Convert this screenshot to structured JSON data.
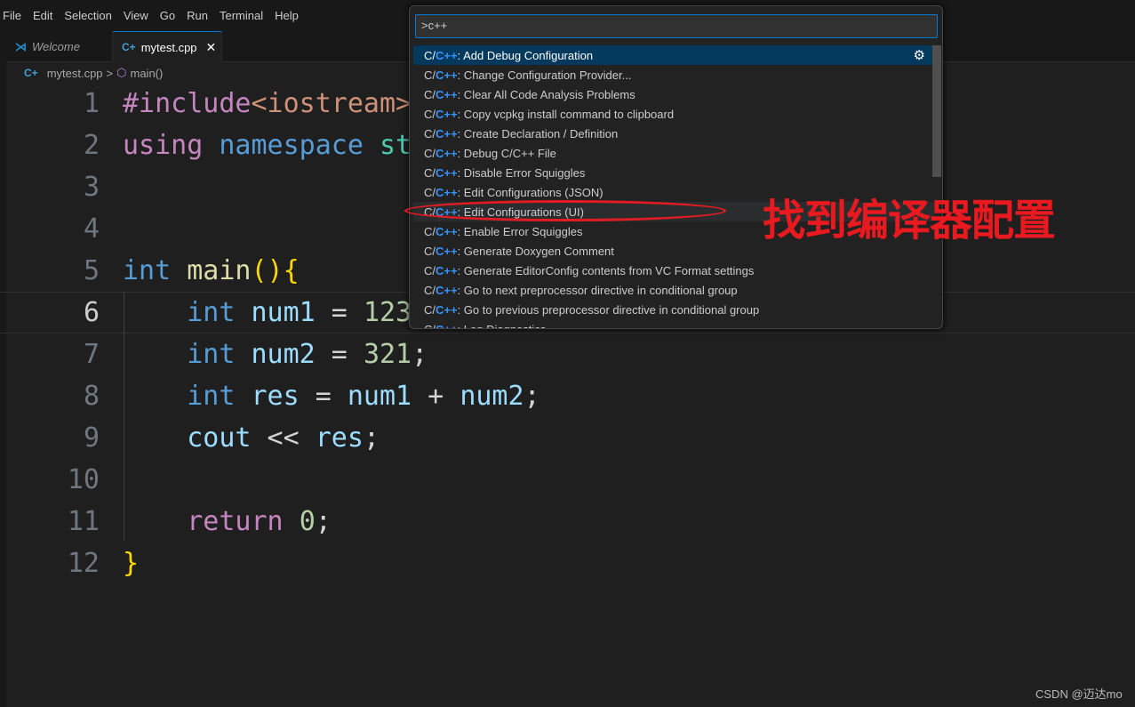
{
  "menu": [
    "File",
    "Edit",
    "Selection",
    "View",
    "Go",
    "Run",
    "Terminal",
    "Help"
  ],
  "tabs": [
    {
      "label": "Welcome",
      "icon": "vscode-icon"
    },
    {
      "label": "mytest.cpp",
      "icon": "cpp-file-icon",
      "close": "✕"
    }
  ],
  "breadcrumb": {
    "file": "mytest.cpp",
    "sep": ">",
    "symbol": "main()"
  },
  "code": {
    "lines": [
      [
        [
          "kp",
          "#include"
        ],
        [
          "ks",
          "<iostream>"
        ]
      ],
      [
        [
          "kp",
          "using"
        ],
        [
          "kw",
          " "
        ],
        [
          "kb",
          "namespace"
        ],
        [
          "kw",
          " "
        ],
        [
          "kt",
          "std"
        ],
        [
          "kw",
          ";"
        ]
      ],
      [],
      [],
      [
        [
          "kb",
          "int"
        ],
        [
          "kw",
          " "
        ],
        [
          "kf",
          "main"
        ],
        [
          "kbr",
          "(){"
        ]
      ],
      [
        [
          "kw",
          "    "
        ],
        [
          "kb",
          "int"
        ],
        [
          "kw",
          " "
        ],
        [
          "kv",
          "num1"
        ],
        [
          "kw",
          " = "
        ],
        [
          "kn",
          "123"
        ],
        [
          "kw",
          ";"
        ]
      ],
      [
        [
          "kw",
          "    "
        ],
        [
          "kb",
          "int"
        ],
        [
          "kw",
          " "
        ],
        [
          "kv",
          "num2"
        ],
        [
          "kw",
          " = "
        ],
        [
          "kn",
          "321"
        ],
        [
          "kw",
          ";"
        ]
      ],
      [
        [
          "kw",
          "    "
        ],
        [
          "kb",
          "int"
        ],
        [
          "kw",
          " "
        ],
        [
          "kv",
          "res"
        ],
        [
          "kw",
          " = "
        ],
        [
          "kv",
          "num1"
        ],
        [
          "kw",
          " + "
        ],
        [
          "kv",
          "num2"
        ],
        [
          "kw",
          ";"
        ]
      ],
      [
        [
          "kw",
          "    "
        ],
        [
          "kv",
          "cout"
        ],
        [
          "kw",
          " << "
        ],
        [
          "kv",
          "res"
        ],
        [
          "kw",
          ";"
        ]
      ],
      [],
      [
        [
          "kw",
          "    "
        ],
        [
          "kp",
          "return"
        ],
        [
          "kw",
          " "
        ],
        [
          "kn",
          "0"
        ],
        [
          "kw",
          ";"
        ]
      ],
      [
        [
          "kbr",
          "}"
        ]
      ]
    ],
    "current_line": 6
  },
  "palette": {
    "input": ">c++",
    "prefix_a": "C/",
    "prefix_b": "C++",
    "items": [
      ": Add Debug Configuration",
      ": Change Configuration Provider...",
      ": Clear All Code Analysis Problems",
      ": Copy vcpkg install command to clipboard",
      ": Create Declaration / Definition",
      ": Debug C/C++ File",
      ": Disable Error Squiggles",
      ": Edit Configurations (JSON)",
      ": Edit Configurations (UI)",
      ": Enable Error Squiggles",
      ": Generate Doxygen Comment",
      ": Generate EditorConfig contents from VC Format settings",
      ": Go to next preprocessor directive in conditional group",
      ": Go to previous preprocessor directive in conditional group",
      ": Log Diagnostics"
    ],
    "selected": 0,
    "hovered": 8
  },
  "annotation": {
    "text": "找到编译器配置",
    "color": "#e8191f"
  },
  "watermark": "CSDN @迈达mo"
}
